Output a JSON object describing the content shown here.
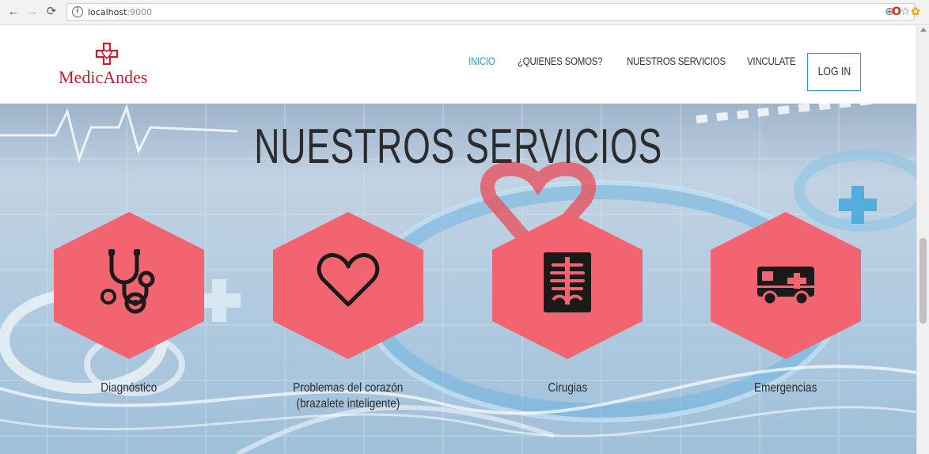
{
  "browser": {
    "url_host": "localhost",
    "url_port": ":9000",
    "info_glyph": "i"
  },
  "site": {
    "logo_text": "MedicAndes",
    "nav": [
      "INICIO",
      "¿QUIENES SOMOS?",
      "NUESTROS SERVICIOS",
      "VINCULATE"
    ],
    "login_label": "LOG IN"
  },
  "hero": {
    "title": "NUESTROS SERVICIOS",
    "services": [
      {
        "label": "Diagnóstico",
        "icon": "stethoscope-icon"
      },
      {
        "label": "Problemas del corazón",
        "label2": "(brazalete inteligente)",
        "icon": "heart-icon"
      },
      {
        "label": "Cirugias",
        "icon": "xray-icon"
      },
      {
        "label": "Emergencias",
        "icon": "ambulance-icon"
      }
    ]
  },
  "colors": {
    "accent": "#2a9fd6",
    "brand_red": "#c81e2d",
    "hexagon": "#f26470",
    "icon": "#1a1a1a"
  }
}
